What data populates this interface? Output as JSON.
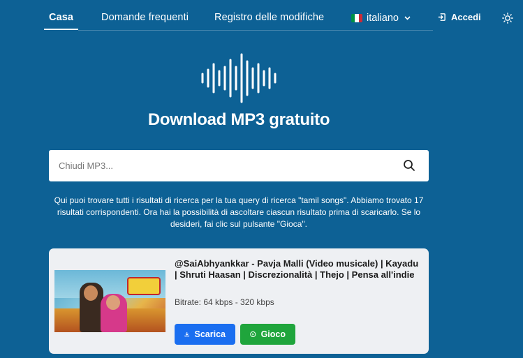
{
  "nav": {
    "items": [
      {
        "label": "Casa",
        "active": true
      },
      {
        "label": "Domande frequenti",
        "active": false
      },
      {
        "label": "Registro delle modifiche",
        "active": false
      }
    ],
    "language": {
      "label": "italiano",
      "flag_colors": [
        "#009246",
        "#ffffff",
        "#ce2b37"
      ]
    },
    "login_label": "Accedi",
    "theme_icon": "sun-icon"
  },
  "hero": {
    "icon": "sound-wave-icon",
    "title": "Download MP3 gratuito"
  },
  "search": {
    "placeholder": "Chiudi MP3...",
    "value": "",
    "icon": "search-icon"
  },
  "info": {
    "text": "Qui puoi trovare tutti i risultati di ricerca per la tua query di ricerca \"tamil songs\". Abbiamo trovato 17 risultati corrispondenti. Ora hai la possibilità di ascoltare ciascun risultato prima di scaricarlo. Se lo desideri, fai clic sul pulsante \"Gioca\"."
  },
  "results": [
    {
      "title": "@SaiAbhyankkar - Pavja Malli (Video musicale) | Kayadu | Shruti Haasan | Discrezionalità | Thejo | Pensa all'indie",
      "bitrate": "Bitrate: 64 kbps - 320 kbps",
      "download_label": "Scarica",
      "play_label": "Gioco",
      "download_color": "#1a6ef0",
      "play_color": "#1fa53c"
    }
  ],
  "colors": {
    "background": "#0d6195",
    "card": "#eef0f3"
  }
}
